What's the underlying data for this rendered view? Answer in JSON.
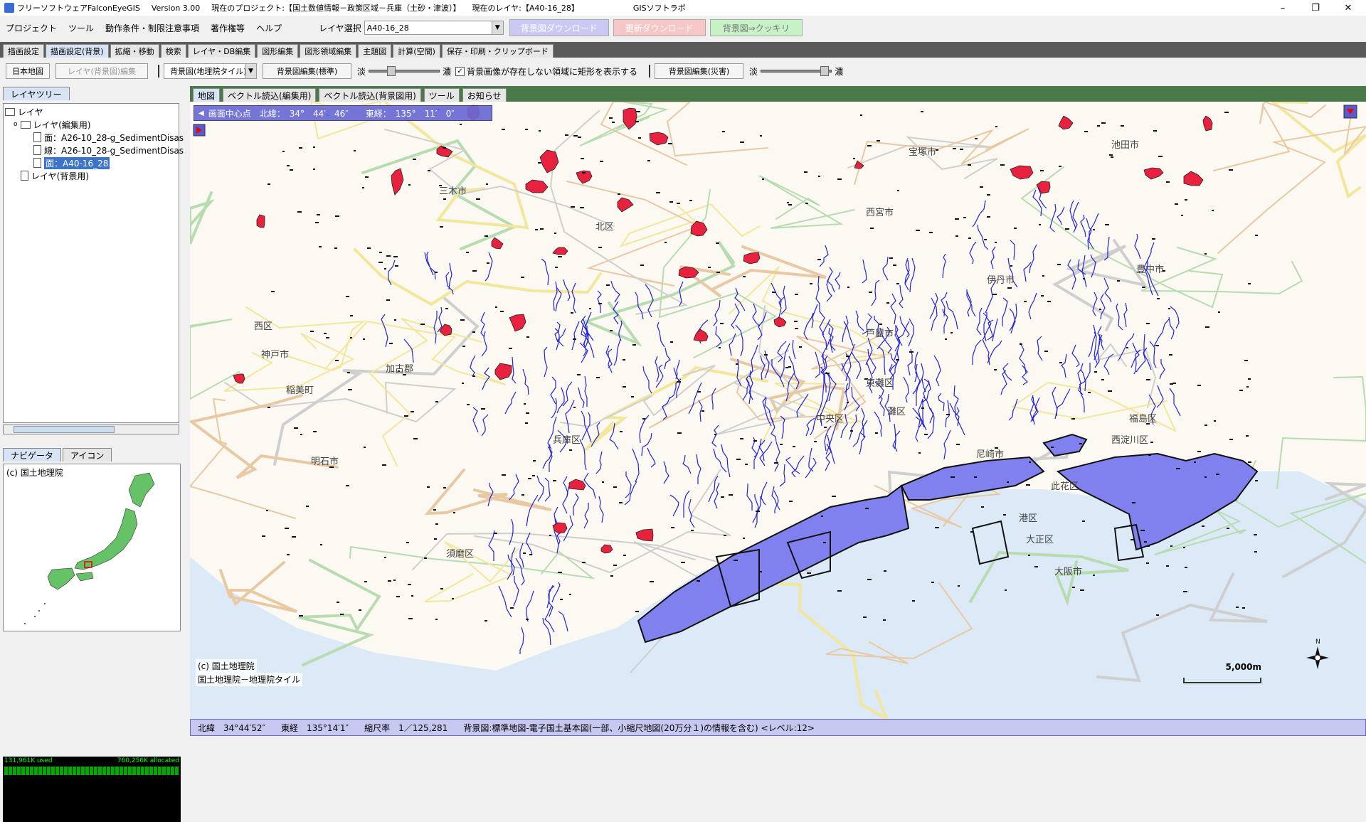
{
  "window": {
    "app_name": "フリーソフトウェアFalconEyeGIS",
    "version": "Version 3.00",
    "project": "現在のプロジェクト:【国土数値情報－政策区域－兵庫（土砂・津波）】",
    "current_layer": "現在のレイヤ:【A40-16_28】",
    "company": "GISソフトラボ",
    "controls": [
      "–",
      "❐",
      "✕"
    ]
  },
  "menu": {
    "items": [
      "プロジェクト",
      "ツール",
      "動作条件・制限注意事項",
      "著作権等",
      "ヘルプ"
    ],
    "layer_select_label": "レイヤ選択",
    "layer_select_value": "A40-16_28",
    "buttons": [
      "背景図ダウンロード",
      "更新ダウンロード",
      "背景図⇒クッキリ"
    ]
  },
  "tabs": [
    "描画設定",
    "描画設定(背景)",
    "拡縮・移動",
    "検索",
    "レイヤ・DB編集",
    "図形編集",
    "図形領域編集",
    "主題図",
    "計算(空間)",
    "保存・印刷・クリップボード"
  ],
  "toolbar": {
    "japan_map": "日本地図",
    "layer_edit": "レイヤ(背景図)編集",
    "bg_select": "背景図(地理院タイル)",
    "bg_edit_standard": "背景図編集(標準)",
    "light": "淡",
    "dark": "濃",
    "checkbox_label": "背景画像が存在しない領域に矩形を表示する",
    "checkbox_checked": "✓",
    "bg_edit_disaster": "背景図編集(災害)",
    "light2": "淡",
    "dark2": "濃",
    "slider1_level": 0.3,
    "slider2_level": 0.95
  },
  "left_panel": {
    "tree_tab": "レイヤツリー",
    "tree": [
      {
        "label": "レイヤ",
        "type": "folder",
        "level": 0
      },
      {
        "label": "レイヤ(編集用)",
        "type": "folder",
        "level": 1
      },
      {
        "label": "面：A26-10_28-g_SedimentDisas",
        "type": "doc",
        "level": 2
      },
      {
        "label": "線：A26-10_28-g_SedimentDisas",
        "type": "doc",
        "level": 2
      },
      {
        "label": "面：A40-16_28",
        "type": "doc",
        "level": 2,
        "selected": true
      },
      {
        "label": "レイヤ(背景用)",
        "type": "doc",
        "level": 1
      }
    ],
    "nav_tabs": [
      "ナビゲータ",
      "アイコン"
    ],
    "nav_copyright": "(c) 国土地理院",
    "memory_used": "131,961K used",
    "memory_alloc": "760,256K allocated"
  },
  "map": {
    "tabs": [
      "地図",
      "ベクトル読込(編集用)",
      "ベクトル読込(背景図用)",
      "ツール",
      "お知らせ"
    ],
    "center_box": "画面中心点　北緯：　34°　44′　46″　　東経：　135°　11′　0″",
    "copyright1": "(c) 国土地理院",
    "copyright2": "国土地理院－地理院タイル",
    "scale_label": "5,000m",
    "labels": [
      "三木市",
      "北区",
      "西区",
      "神戸市",
      "稲美町",
      "加古郡",
      "明石市",
      "伊丹市",
      "尼崎市",
      "池田市",
      "大阪市",
      "西淀川区",
      "此花区",
      "港区",
      "大正区",
      "福島区",
      "豊中市",
      "宝塚市",
      "須磨区",
      "兵庫区",
      "中央区",
      "灘区",
      "東灘区",
      "芦屋市",
      "西宮市"
    ],
    "status": {
      "lat": "北緯　34°44′52″",
      "lon": "東経　135°14′1″",
      "scale": "縮尺率　1／125,281",
      "bg": "背景図:標準地図-電子国土基本図(一部、小縮尺地図(20万分１)の情報を含む) <レベル:12>"
    }
  },
  "colors": {
    "sediment": "#e8213f",
    "tsunami": "#8080ee",
    "river": "#2222dd",
    "sea": "#dce9f6",
    "road_yellow": "#f2e79a",
    "road_green": "#b7dcb0"
  }
}
